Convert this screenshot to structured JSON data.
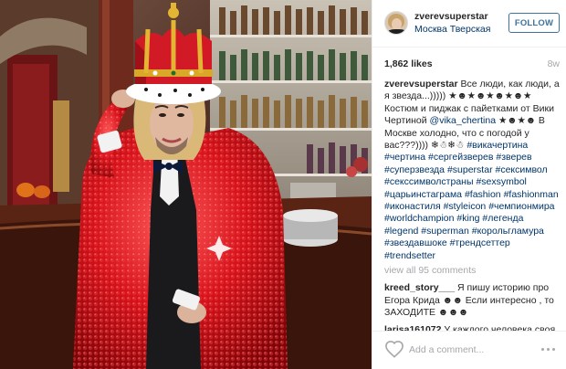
{
  "post": {
    "username": "zverevsuperstar",
    "location": "Москва Тверская",
    "follow_label": "FOLLOW",
    "likes": "1,862 likes",
    "time_ago": "8w",
    "photo_alt": "man in crown and red sequin jacket at a bar"
  },
  "caption": {
    "author": "zverevsuperstar",
    "text_1": " Все люди, как люди, а я звезда...))))) ★☻★☻★☻★☻★ Костюм и пиджак с пайетками от Вики Чертиной ",
    "mention": "@vika_chertina",
    "text_2": " ★☻★☻ В Москве холодно, что с погодой у вас???)))) ❄☃❄☃ ",
    "hashtags": [
      "#викачертина",
      "#чертина",
      "#сергейзверев",
      "#зверев",
      "#суперзвезда",
      "#superstar",
      "#сексимвол",
      "#секссимволстраны",
      "#sexsymbol",
      "#царьинстаграма",
      "#fashion",
      "#fashionman",
      "#иконастиля",
      "#styleicon",
      "#чемпионмира",
      "#worldchampion",
      "#king",
      "#легенда",
      "#legend",
      "#superman",
      "#корольгламура",
      "#звездавшоке",
      "#трендсеттер",
      "#trendsetter"
    ]
  },
  "comments": {
    "view_all": "view all 95 comments",
    "items": [
      {
        "user": "kreed_story___",
        "text": " Я пишу историю про Егора Крида ☻☻ Если интересно , то ЗАХОДИТЕ ☻☻☻"
      },
      {
        "user": "larisa161072",
        "text": " У каждого человека своя жизнь.Он живет,так как хочет.Что Вы"
      }
    ]
  },
  "footer": {
    "comment_placeholder": "Add a comment..."
  },
  "icons": {
    "heart": "heart-icon",
    "more": "more-options-icon"
  },
  "colors": {
    "link": "#003569",
    "follow": "#3f729b",
    "muted": "#a5a7aa",
    "text": "#262626"
  }
}
